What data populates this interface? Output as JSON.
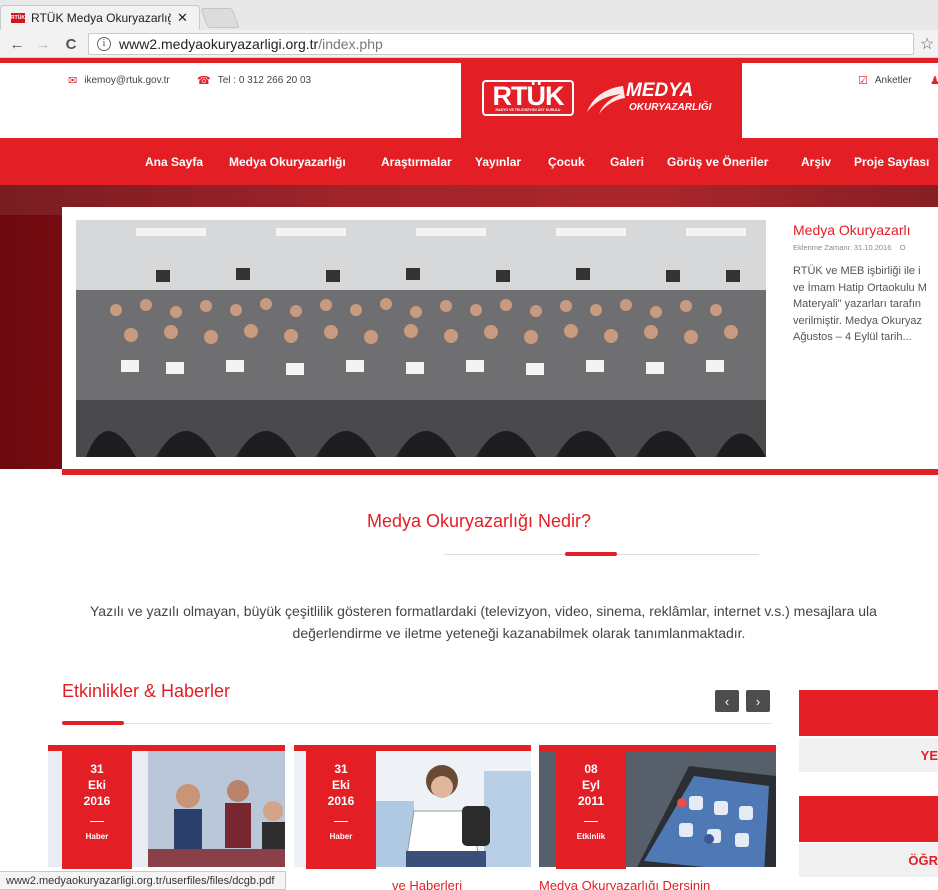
{
  "browser": {
    "tab_title": "RTÜK Medya Okuryazarlığ",
    "favicon_text": "RTÜK",
    "close_glyph": "✕",
    "url_host": "www2.medyaokuryazarligi.org.tr",
    "url_path": "/index.php",
    "info_glyph": "i",
    "star_glyph": "☆",
    "back_glyph": "←",
    "forward_glyph": "→",
    "reload_glyph": "C",
    "status_url": "www2.medyaokuryazarligi.org.tr/userfiles/files/dcgb.pdf"
  },
  "header": {
    "email": "ikemoy@rtuk.gov.tr",
    "phone": "Tel : 0 312 266 20 03",
    "surveys": "Anketler",
    "email_icon": "✉",
    "phone_icon": "☎",
    "survey_icon": "☑",
    "logo_rtuk": "RTÜK",
    "logo_rtuk_sub": "RADYO VE TELEVİZYON ÜST KURULU",
    "logo_medya": "MEDYA",
    "logo_okuryazarligi": "OKURYAZARLIĞI",
    "accent_color": "#e31e25"
  },
  "nav": {
    "items": [
      "Ana Sayfa",
      "Medya Okuryazarlığı",
      "Araştırmalar",
      "Yayınlar",
      "Çocuk",
      "Galeri",
      "Görüş ve Öneriler",
      "Arşiv",
      "Proje Sayfası"
    ]
  },
  "slider": {
    "title": "Medya Okuryazarlı",
    "date": "Eklenme Zamanı: 31.10.2016",
    "date_tail": "O",
    "text_lines": [
      "RTÜK ve MEB işbirliği ile i",
      "ve İmam Hatip Ortaokulu M",
      "Materyali\" yazarları tarafın",
      "verilmiştir. Medya Okuryaz",
      "Ağustos – 4 Eylül tarih..."
    ]
  },
  "about": {
    "title": "Medya Okuryazarlığı Nedir?",
    "line1": "Yazılı ve yazılı olmayan, büyük çeşitlilik gösteren formatlardaki (televizyon, video, sinema, reklâmlar, internet v.s.) mesajlara ula",
    "line2": "değerlendirme ve iletme yeteneği kazanabilmek olarak tanımlanmaktadır."
  },
  "news": {
    "title": "Etkinlikler & Haberler",
    "prev": "‹",
    "next": "›",
    "items": [
      {
        "day": "31",
        "month": "Eki",
        "year": "2016",
        "category": "Haber",
        "title": ""
      },
      {
        "day": "31",
        "month": "Eki",
        "year": "2016",
        "category": "Haber",
        "title": "ve Haberleri"
      },
      {
        "day": "08",
        "month": "Eyl",
        "year": "2011",
        "category": "Etkinlik",
        "title": "Medya Okuryazarlığı Dersinin"
      }
    ]
  },
  "side": {
    "panel1": "YE",
    "panel2": "ÖĞR"
  }
}
